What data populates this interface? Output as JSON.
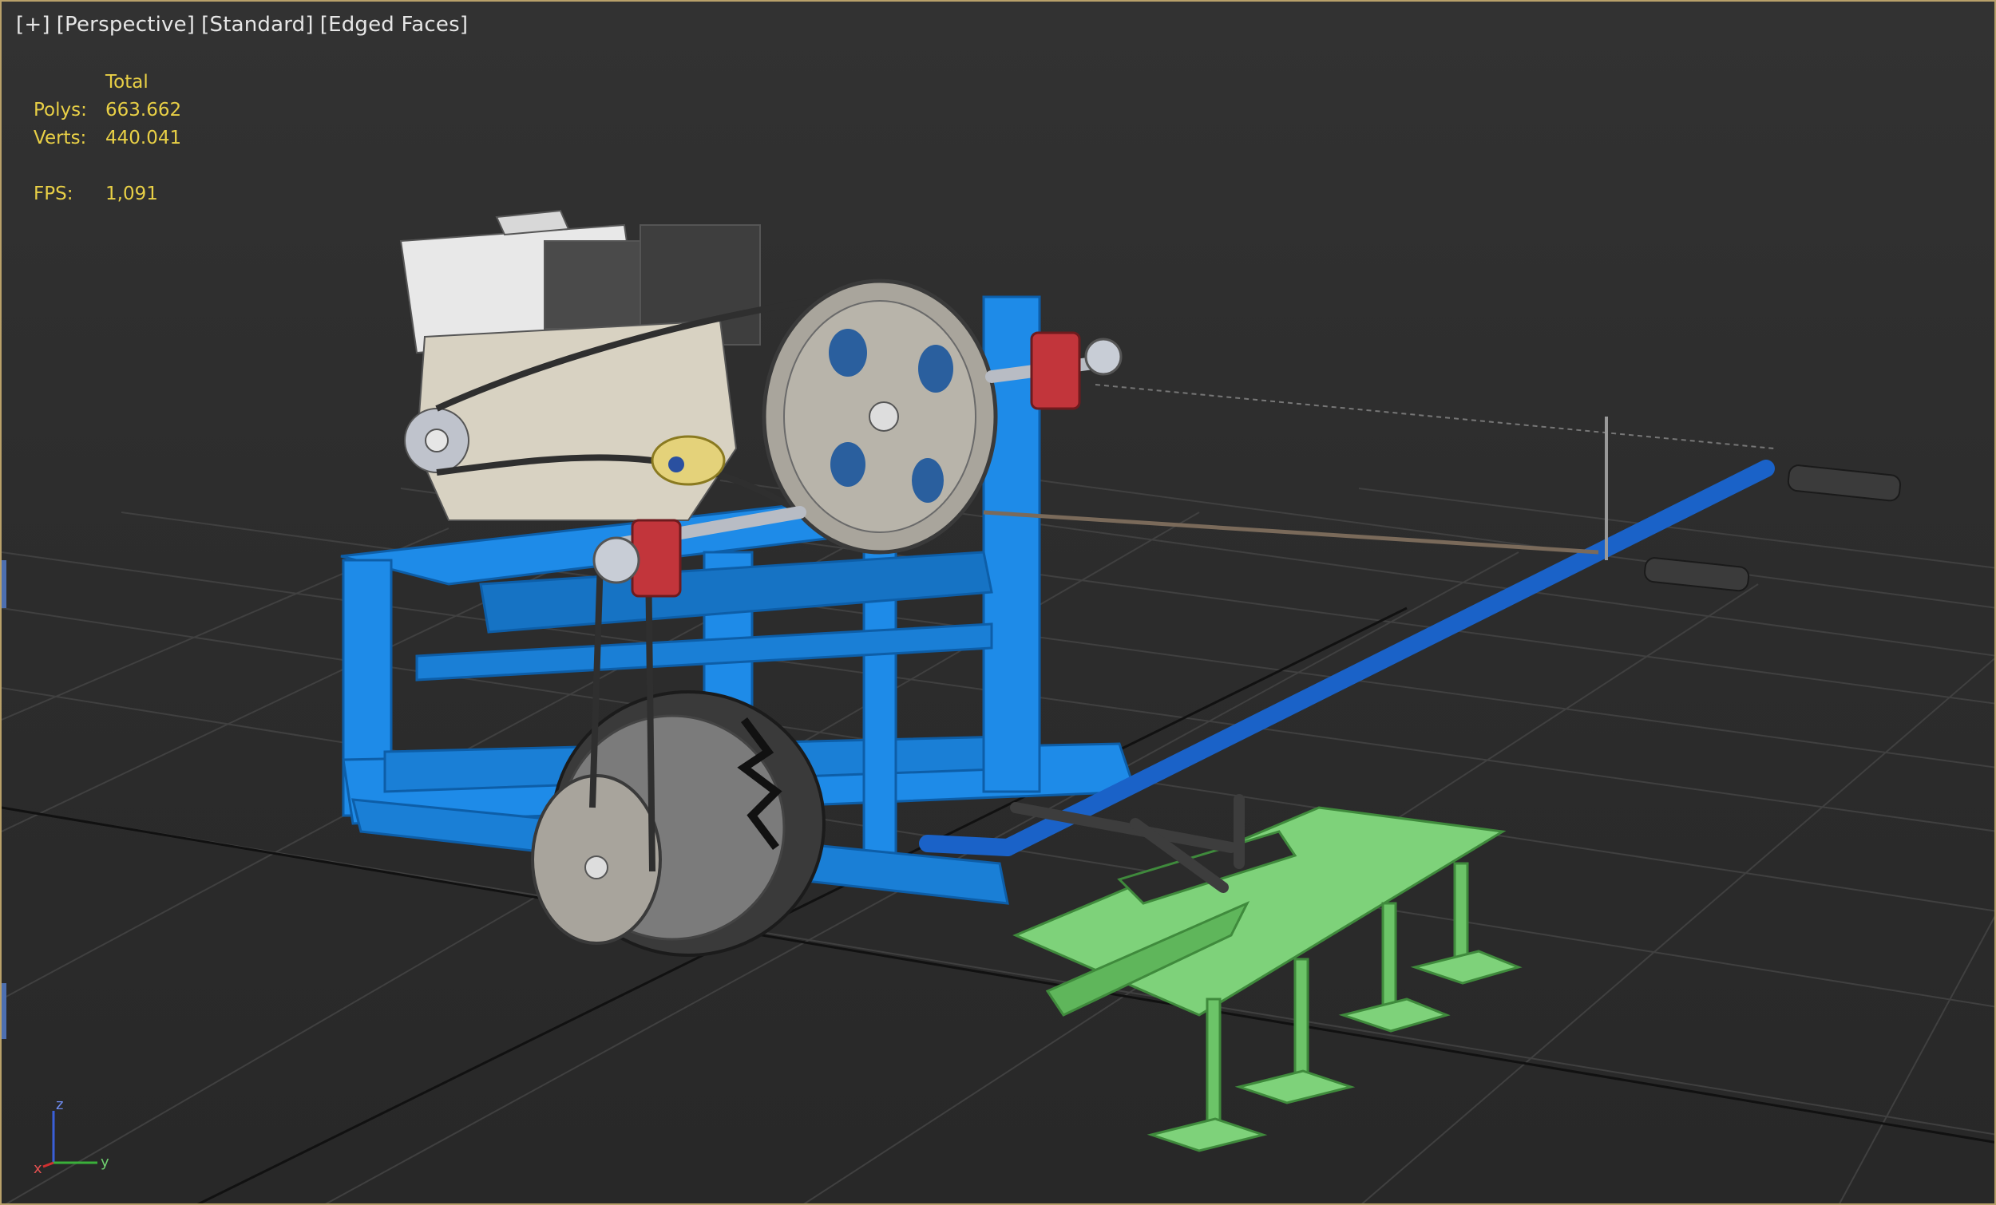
{
  "viewport": {
    "label_parts": [
      "[+]",
      "[Perspective]",
      "[Standard]",
      "[Edged Faces]"
    ]
  },
  "stats": {
    "header": "Total",
    "polys_label": "Polys:",
    "polys_value": "663.662",
    "verts_label": "Verts:",
    "verts_value": "440.041",
    "fps_label": "FPS:",
    "fps_value": "1,091"
  },
  "axis_gizmo": {
    "z_label": "z",
    "x_label": "x",
    "y_label": "y"
  },
  "colors": {
    "frame_blue": "#1e8be8",
    "implement_green": "#7ed27a",
    "engine_white": "#e8e8e8",
    "hud_yellow": "#e9d046",
    "grid": "#3d3d3d",
    "bearing_red": "#c2353b"
  },
  "scene_objects": [
    "engine",
    "drive-pulley",
    "bearing-blocks",
    "main-frame",
    "wheel",
    "handlebar",
    "grips",
    "tiller-implement"
  ]
}
